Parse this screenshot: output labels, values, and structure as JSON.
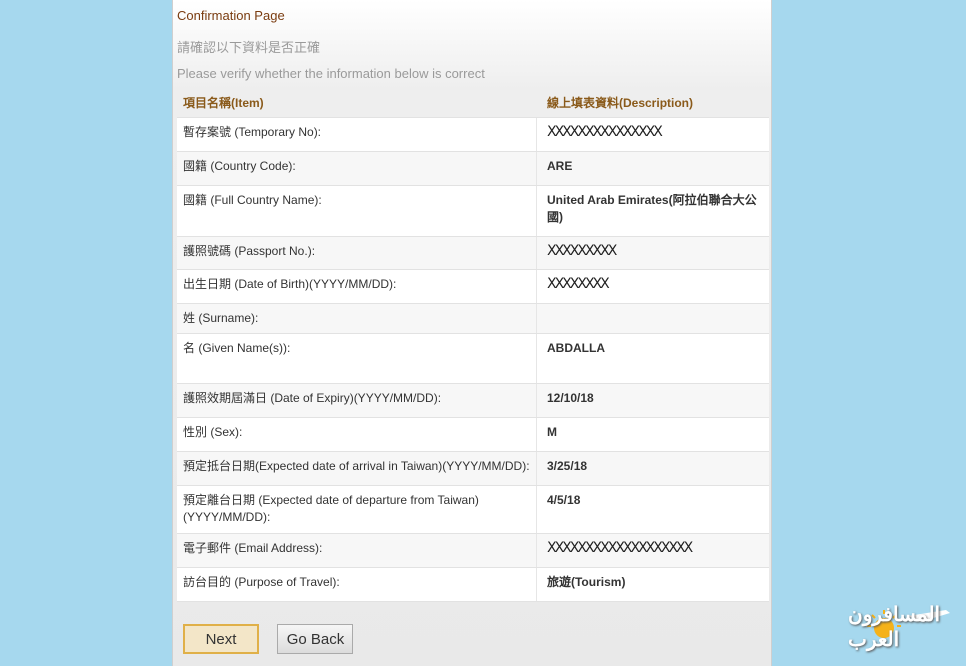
{
  "page": {
    "title": "Confirmation Page",
    "subtitle_zh": "請確認以下資料是否正確",
    "subtitle_en": "Please verify whether the information below is correct"
  },
  "table": {
    "header": {
      "item": "項目名稱(Item)",
      "description": "線上填表資料(Description)"
    },
    "rows": [
      {
        "item": "暫存案號 (Temporary No):",
        "description": "XXXXXXXXXXXXXXX",
        "masked": true
      },
      {
        "item": "國籍 (Country Code):",
        "description": "ARE",
        "masked": false
      },
      {
        "item": "國籍 (Full Country Name):",
        "description": "United Arab Emirates(阿拉伯聯合大公國)",
        "masked": false
      },
      {
        "item": "護照號碼 (Passport No.):",
        "description": "XXXXXXXXX",
        "masked": true
      },
      {
        "item": "出生日期 (Date of Birth)(YYYY/MM/DD):",
        "description": "XXXXXXXX",
        "masked": true
      },
      {
        "item": "姓 (Surname):",
        "description": "",
        "masked": false
      },
      {
        "item": "名 (Given Name(s)):",
        "description": "ABDALLA",
        "masked": false
      },
      {
        "item": "護照效期屆滿日 (Date of Expiry)(YYYY/MM/DD):",
        "description": "12/10/18",
        "masked": false
      },
      {
        "item": "性別 (Sex):",
        "description": "M",
        "masked": false
      },
      {
        "item": "預定抵台日期(Expected date of arrival in Taiwan)(YYYY/MM/DD):",
        "description": "3/25/18",
        "masked": false
      },
      {
        "item": "預定離台日期 (Expected date of departure from Taiwan)(YYYY/MM/DD):",
        "description": "4/5/18",
        "masked": false
      },
      {
        "item": "電子郵件 (Email Address):",
        "description": "XXXXXXXXXXXXXXXXXXX",
        "masked": true
      },
      {
        "item": "訪台目的 (Purpose of Travel):",
        "description": "旅遊(Tourism)",
        "masked": false
      }
    ]
  },
  "buttons": {
    "next": "Next",
    "go_back": "Go Back"
  },
  "watermark": {
    "text": "المسافرون العرب"
  },
  "colors": {
    "background": "#a6d8ee",
    "title": "#7a3c10",
    "header_text": "#8a5a1a",
    "primary_border": "#e0b048"
  }
}
